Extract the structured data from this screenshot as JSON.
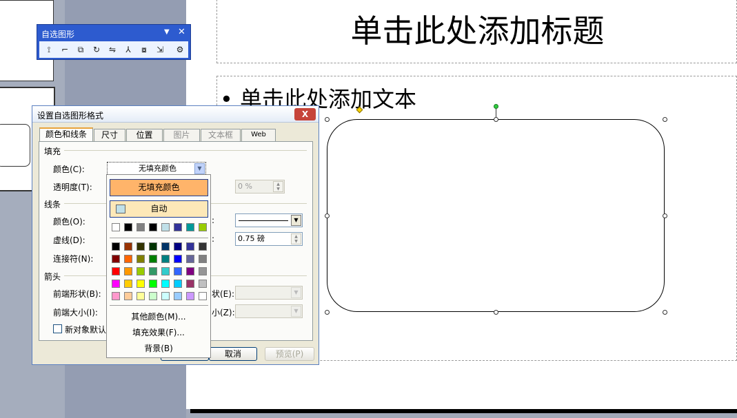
{
  "toolbar": {
    "title": "自选图形",
    "dropdown": "▼",
    "close": "✕",
    "tools": [
      "⟟",
      "⌐",
      "⧉",
      "↻",
      "⇋",
      "⅄",
      "⧇",
      "⇲",
      "⚙"
    ]
  },
  "slide": {
    "title": "单击此处添加标题",
    "bullet": "•",
    "body": "单击此处添加文本"
  },
  "dialog": {
    "title": "设置自选图形格式",
    "close": "X",
    "tabs": [
      "颜色和线条",
      "尺寸",
      "位置",
      "图片",
      "文本框",
      "Web"
    ],
    "fill_section": "填充",
    "fill_color_label": "颜色(C):",
    "fill_color_value": "无填充颜色",
    "transparency_label": "透明度(T):",
    "transparency_value": "0 %",
    "line_section": "线条",
    "line_color_label": "颜色(O):",
    "dash_label": "虚线(D):",
    "connector_label": "连接符(N):",
    "style_label_tail": ":",
    "weight_label_tail": ":",
    "weight_value": "0.75 磅",
    "arrows_section": "箭头",
    "begin_style_label": "前端形状(B):",
    "begin_size_label": "前端大小(I):",
    "end_style_label_tail": "状(E):",
    "end_size_label_tail": "小(Z):",
    "default_checkbox": "新对象默认值",
    "ok": "确定",
    "cancel": "取消",
    "preview": "预览(P)"
  },
  "color_popup": {
    "no_fill": "无填充颜色",
    "automatic": "自动",
    "more_colors": "其他颜色(M)...",
    "fill_effects": "填充效果(F)...",
    "background": "背景(B)",
    "scheme_colors": [
      "#ffffff",
      "#000000",
      "#808080",
      "#000000",
      "#c0e0e8",
      "#333399",
      "#009999",
      "#99cc00"
    ],
    "standard_colors": [
      [
        "#000000",
        "#993300",
        "#333300",
        "#003300",
        "#003366",
        "#000080",
        "#333399",
        "#333333"
      ],
      [
        "#800000",
        "#ff6600",
        "#808000",
        "#008000",
        "#008080",
        "#0000ff",
        "#666699",
        "#808080"
      ],
      [
        "#ff0000",
        "#ff9900",
        "#99cc00",
        "#339966",
        "#33cccc",
        "#3366ff",
        "#800080",
        "#969696"
      ],
      [
        "#ff00ff",
        "#ffcc00",
        "#ffff00",
        "#00ff00",
        "#00ffff",
        "#00ccff",
        "#993366",
        "#c0c0c0"
      ],
      [
        "#ff99cc",
        "#ffcc99",
        "#ffff99",
        "#ccffcc",
        "#ccffff",
        "#99ccff",
        "#cc99ff",
        "#ffffff"
      ]
    ]
  },
  "colors": {
    "toolbar_blue": "#2d5bcf",
    "no_fill_highlight": "#ffb46a",
    "automatic_highlight": "#fde8b8",
    "automatic_swatch": "#c0e0e8",
    "tab_accent": "#e8a33c",
    "close_red": "#c6443a",
    "adjust_handle": "#f5d200",
    "rotate_handle": "#2ecc40"
  }
}
